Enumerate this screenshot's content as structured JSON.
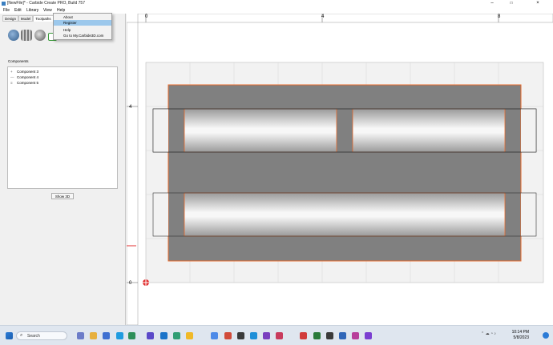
{
  "window": {
    "title": "[NewFile]* - Carbide Create PRO, Build 757"
  },
  "menu": {
    "items": [
      "File",
      "Edit",
      "Library",
      "View",
      "Help"
    ]
  },
  "help_menu": {
    "items": [
      "About",
      "Register",
      "Help",
      "Go to My.Carbide3D.com"
    ],
    "highlighted": "Register"
  },
  "tabs": [
    "Design",
    "Model",
    "Toolpaths"
  ],
  "components_panel": {
    "label": "Components",
    "items": [
      {
        "glyph": "+",
        "label": "Component 3"
      },
      {
        "glyph": "—",
        "label": "Component 4"
      },
      {
        "glyph": "≡",
        "label": "Component 5"
      }
    ]
  },
  "show3d_button": "Show 3D",
  "ruler": {
    "top_labels": [
      "0",
      "4",
      "8"
    ],
    "left_labels": [
      "4",
      "0"
    ]
  },
  "taskbar": {
    "search_label": "Search",
    "time": "10:14 PM",
    "date": "5/8/2023"
  },
  "colors": {
    "stock": "#808080",
    "outline": "#e8692a",
    "highlight": "#9cc8ec"
  }
}
